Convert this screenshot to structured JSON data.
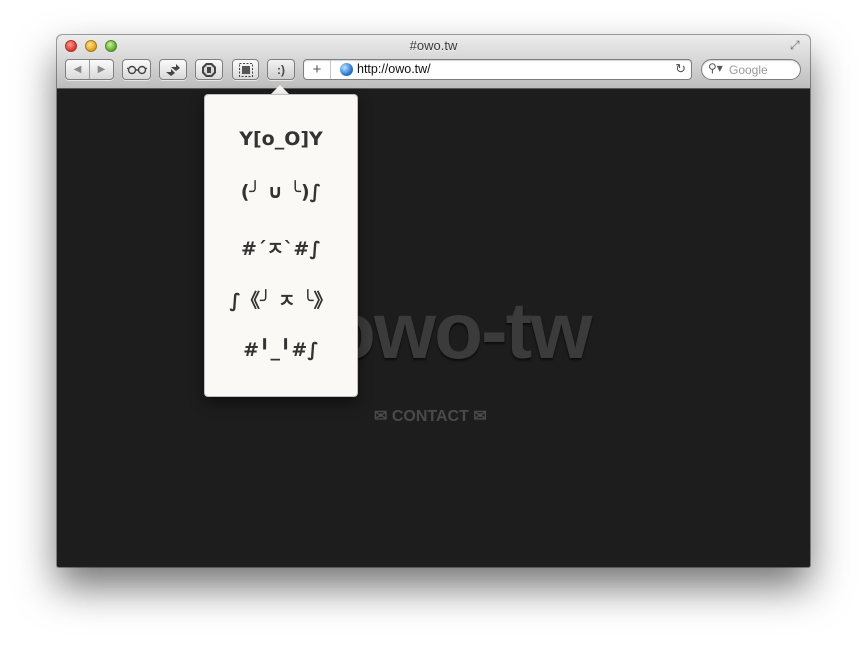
{
  "window": {
    "title": "#owo.tw"
  },
  "toolbar": {
    "back_icon": "left-arrow-icon",
    "forward_icon": "right-arrow-icon",
    "buttons": [
      {
        "icon": "reader-glasses-icon",
        "glyph": "👓"
      },
      {
        "icon": "share-icon",
        "glyph": "⇶"
      },
      {
        "icon": "adblock-shield-icon",
        "glyph": "⬢"
      },
      {
        "icon": "screenshot-icon",
        "glyph": "▣"
      },
      {
        "icon": "emoticon-icon",
        "glyph": ":)"
      }
    ]
  },
  "address_bar": {
    "plus": "+",
    "url": "http://owo.tw/",
    "reload": "↻"
  },
  "search": {
    "placeholder": "Google"
  },
  "page": {
    "logo": "owo-tw",
    "contact": "✉ CONTACT ✉"
  },
  "popover": {
    "emoticons": [
      "Y[o_O]Y",
      "(╯ ∪ ╰)∫",
      "#´ㅈ`#∫",
      "∫《╯ ㅈ ╰》",
      "#╹_╹#∫"
    ]
  }
}
